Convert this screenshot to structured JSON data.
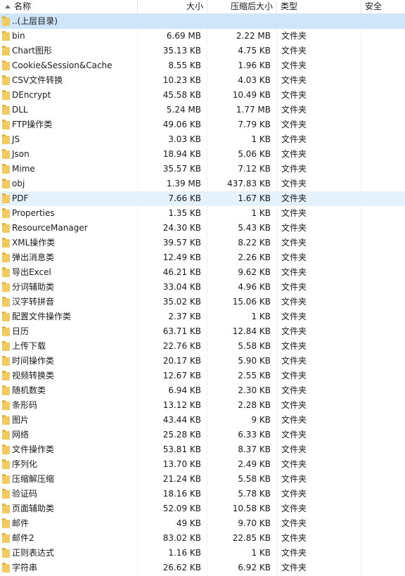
{
  "columns": {
    "name": "名称",
    "size": "大小",
    "compressed": "压缩后大小",
    "type": "类型",
    "security": "安全"
  },
  "parent_row": {
    "name": "..(上层目录)"
  },
  "rows": [
    {
      "name": "bin",
      "size": "6.69 MB",
      "compressed": "2.22 MB",
      "type": "文件夹"
    },
    {
      "name": "Chart图形",
      "size": "35.13 KB",
      "compressed": "4.75 KB",
      "type": "文件夹"
    },
    {
      "name": "Cookie&Session&Cache",
      "size": "8.55 KB",
      "compressed": "1.96 KB",
      "type": "文件夹"
    },
    {
      "name": "CSV文件转换",
      "size": "10.23 KB",
      "compressed": "4.03 KB",
      "type": "文件夹"
    },
    {
      "name": "DEncrypt",
      "size": "45.58 KB",
      "compressed": "10.49 KB",
      "type": "文件夹"
    },
    {
      "name": "DLL",
      "size": "5.24 MB",
      "compressed": "1.77 MB",
      "type": "文件夹"
    },
    {
      "name": "FTP操作类",
      "size": "49.06 KB",
      "compressed": "7.79 KB",
      "type": "文件夹"
    },
    {
      "name": "JS",
      "size": "3.03 KB",
      "compressed": "1 KB",
      "type": "文件夹"
    },
    {
      "name": "Json",
      "size": "18.94 KB",
      "compressed": "5.06 KB",
      "type": "文件夹"
    },
    {
      "name": "Mime",
      "size": "35.57 KB",
      "compressed": "7.12 KB",
      "type": "文件夹"
    },
    {
      "name": "obj",
      "size": "1.39 MB",
      "compressed": "437.83 KB",
      "type": "文件夹"
    },
    {
      "name": "PDF",
      "size": "7.66 KB",
      "compressed": "1.67 KB",
      "type": "文件夹",
      "hover": true
    },
    {
      "name": "Properties",
      "size": "1.35 KB",
      "compressed": "1 KB",
      "type": "文件夹"
    },
    {
      "name": "ResourceManager",
      "size": "24.30 KB",
      "compressed": "5.43 KB",
      "type": "文件夹"
    },
    {
      "name": "XML操作类",
      "size": "39.57 KB",
      "compressed": "8.22 KB",
      "type": "文件夹"
    },
    {
      "name": "弹出消息类",
      "size": "12.49 KB",
      "compressed": "2.26 KB",
      "type": "文件夹"
    },
    {
      "name": "导出Excel",
      "size": "46.21 KB",
      "compressed": "9.62 KB",
      "type": "文件夹"
    },
    {
      "name": "分词辅助类",
      "size": "33.04 KB",
      "compressed": "4.96 KB",
      "type": "文件夹"
    },
    {
      "name": "汉字转拼音",
      "size": "35.02 KB",
      "compressed": "15.06 KB",
      "type": "文件夹"
    },
    {
      "name": "配置文件操作类",
      "size": "2.37 KB",
      "compressed": "1 KB",
      "type": "文件夹"
    },
    {
      "name": "日历",
      "size": "63.71 KB",
      "compressed": "12.84 KB",
      "type": "文件夹"
    },
    {
      "name": "上传下载",
      "size": "22.76 KB",
      "compressed": "5.58 KB",
      "type": "文件夹"
    },
    {
      "name": "时间操作类",
      "size": "20.17 KB",
      "compressed": "5.90 KB",
      "type": "文件夹"
    },
    {
      "name": "视频转换类",
      "size": "12.67 KB",
      "compressed": "2.55 KB",
      "type": "文件夹"
    },
    {
      "name": "随机数类",
      "size": "6.94 KB",
      "compressed": "2.30 KB",
      "type": "文件夹"
    },
    {
      "name": "条形码",
      "size": "13.12 KB",
      "compressed": "2.28 KB",
      "type": "文件夹"
    },
    {
      "name": "图片",
      "size": "43.44 KB",
      "compressed": "9 KB",
      "type": "文件夹"
    },
    {
      "name": "网络",
      "size": "25.28 KB",
      "compressed": "6.33 KB",
      "type": "文件夹"
    },
    {
      "name": "文件操作类",
      "size": "53.81 KB",
      "compressed": "8.37 KB",
      "type": "文件夹"
    },
    {
      "name": "序列化",
      "size": "13.70 KB",
      "compressed": "2.49 KB",
      "type": "文件夹"
    },
    {
      "name": "压缩解压缩",
      "size": "21.24 KB",
      "compressed": "5.58 KB",
      "type": "文件夹"
    },
    {
      "name": "验证码",
      "size": "18.16 KB",
      "compressed": "5.78 KB",
      "type": "文件夹"
    },
    {
      "name": "页面辅助类",
      "size": "52.09 KB",
      "compressed": "10.58 KB",
      "type": "文件夹"
    },
    {
      "name": "邮件",
      "size": "49 KB",
      "compressed": "9.70 KB",
      "type": "文件夹"
    },
    {
      "name": "邮件2",
      "size": "83.02 KB",
      "compressed": "22.85 KB",
      "type": "文件夹"
    },
    {
      "name": "正则表达式",
      "size": "1.16 KB",
      "compressed": "1 KB",
      "type": "文件夹"
    },
    {
      "name": "字符串",
      "size": "26.62 KB",
      "compressed": "6.92 KB",
      "type": "文件夹"
    }
  ],
  "colors": {
    "folder": "#f1cb5f",
    "selected_row": "#cfe5fa",
    "hover_row": "#e5f1fb"
  }
}
